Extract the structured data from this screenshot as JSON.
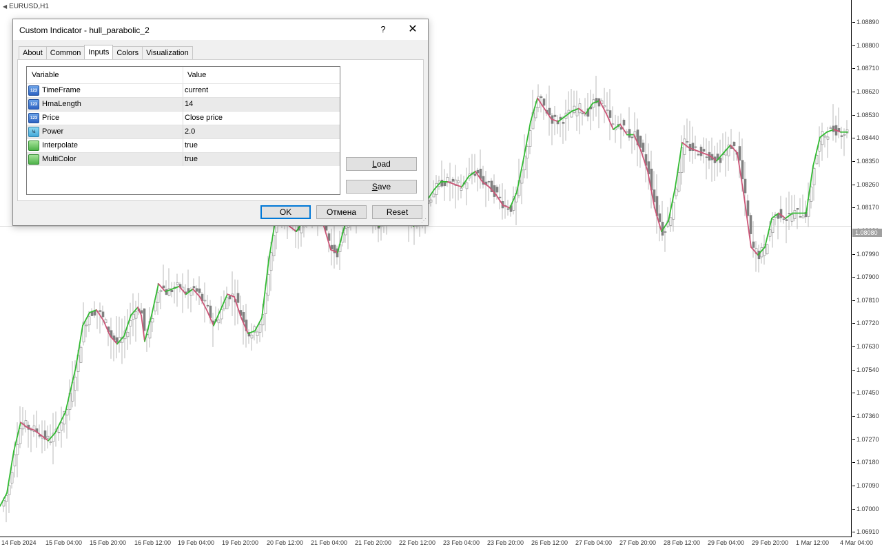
{
  "chart": {
    "symbol_label": "EURUSD,H1",
    "price_ticks": [
      "1.08890",
      "1.08800",
      "1.08710",
      "1.08620",
      "1.08530",
      "1.08440",
      "1.08350",
      "1.08260",
      "1.08170",
      "1.08080",
      "1.07990",
      "1.07900",
      "1.07810",
      "1.07720",
      "1.07630",
      "1.07540",
      "1.07450",
      "1.07360",
      "1.07270",
      "1.07180",
      "1.07090",
      "1.07000",
      "1.06910"
    ],
    "current_price": "1.08080",
    "time_ticks": [
      "14 Feb 2024",
      "15 Feb 04:00",
      "15 Feb 20:00",
      "16 Feb 12:00",
      "19 Feb 04:00",
      "19 Feb 20:00",
      "20 Feb 12:00",
      "21 Feb 04:00",
      "21 Feb 20:00",
      "22 Feb 12:00",
      "23 Feb 04:00",
      "23 Feb 20:00",
      "26 Feb 12:00",
      "27 Feb 04:00",
      "27 Feb 20:00",
      "28 Feb 12:00",
      "29 Feb 04:00",
      "29 Feb 20:00",
      "1 Mar 12:00",
      "4 Mar 04:00"
    ],
    "colors": {
      "up": "#33bb33",
      "down": "#cc5577",
      "candle": "#808080",
      "wick": "#b8b8b8"
    },
    "ylim": [
      1.06891,
      1.08945
    ],
    "hma_path": [
      [
        0,
        1.0701
      ],
      [
        10,
        1.0706
      ],
      [
        20,
        1.0722
      ],
      [
        30,
        1.0733
      ],
      [
        40,
        1.0731
      ],
      [
        50,
        1.073
      ],
      [
        60,
        1.0728
      ],
      [
        70,
        1.0726
      ],
      [
        80,
        1.0729
      ],
      [
        95,
        1.0737
      ],
      [
        110,
        1.0754
      ],
      [
        120,
        1.077
      ],
      [
        130,
        1.0775
      ],
      [
        140,
        1.0776
      ],
      [
        150,
        1.0772
      ],
      [
        160,
        1.0766
      ],
      [
        170,
        1.0763
      ],
      [
        180,
        1.0766
      ],
      [
        190,
        1.0774
      ],
      [
        200,
        1.0777
      ],
      [
        205,
        1.0774
      ],
      [
        210,
        1.0764
      ],
      [
        220,
        1.0774
      ],
      [
        230,
        1.0786
      ],
      [
        240,
        1.0783
      ],
      [
        250,
        1.0784
      ],
      [
        260,
        1.0785
      ],
      [
        270,
        1.0782
      ],
      [
        280,
        1.0784
      ],
      [
        290,
        1.0781
      ],
      [
        300,
        1.0776
      ],
      [
        310,
        1.077
      ],
      [
        320,
        1.0776
      ],
      [
        330,
        1.0782
      ],
      [
        340,
        1.0781
      ],
      [
        350,
        1.0773
      ],
      [
        360,
        1.0767
      ],
      [
        370,
        1.0768
      ],
      [
        380,
        1.0773
      ],
      [
        390,
        1.0795
      ],
      [
        400,
        1.0811
      ],
      [
        410,
        1.0813
      ],
      [
        420,
        1.0808
      ],
      [
        430,
        1.0806
      ],
      [
        440,
        1.081
      ],
      [
        450,
        1.0816
      ],
      [
        460,
        1.0814
      ],
      [
        470,
        1.0808
      ],
      [
        480,
        1.0799
      ],
      [
        490,
        1.0798
      ],
      [
        500,
        1.0808
      ],
      [
        510,
        1.0812
      ],
      [
        520,
        1.0818
      ],
      [
        530,
        1.0817
      ],
      [
        540,
        1.0811
      ],
      [
        550,
        1.0808
      ],
      [
        560,
        1.0811
      ],
      [
        570,
        1.082
      ],
      [
        580,
        1.0819
      ],
      [
        590,
        1.0812
      ],
      [
        600,
        1.0808
      ],
      [
        610,
        1.0814
      ],
      [
        620,
        1.0818
      ],
      [
        630,
        1.0822
      ],
      [
        640,
        1.0825
      ],
      [
        650,
        1.0825
      ],
      [
        660,
        1.0824
      ],
      [
        670,
        1.0823
      ],
      [
        680,
        1.0827
      ],
      [
        690,
        1.0829
      ],
      [
        700,
        1.0825
      ],
      [
        710,
        1.0823
      ],
      [
        720,
        1.082
      ],
      [
        730,
        1.0816
      ],
      [
        740,
        1.0815
      ],
      [
        750,
        1.0821
      ],
      [
        760,
        1.0834
      ],
      [
        770,
        1.0848
      ],
      [
        780,
        1.0857
      ],
      [
        790,
        1.0853
      ],
      [
        800,
        1.0849
      ],
      [
        810,
        1.0848
      ],
      [
        820,
        1.085
      ],
      [
        830,
        1.0852
      ],
      [
        840,
        1.0853
      ],
      [
        850,
        1.0851
      ],
      [
        860,
        1.0855
      ],
      [
        870,
        1.0856
      ],
      [
        880,
        1.0851
      ],
      [
        890,
        1.0845
      ],
      [
        900,
        1.0847
      ],
      [
        910,
        1.0843
      ],
      [
        920,
        1.0843
      ],
      [
        930,
        1.0837
      ],
      [
        940,
        1.0829
      ],
      [
        950,
        1.0815
      ],
      [
        960,
        1.0806
      ],
      [
        970,
        1.081
      ],
      [
        980,
        1.0823
      ],
      [
        990,
        1.084
      ],
      [
        1000,
        1.0838
      ],
      [
        1010,
        1.0837
      ],
      [
        1020,
        1.0836
      ],
      [
        1030,
        1.0835
      ],
      [
        1040,
        1.0833
      ],
      [
        1050,
        1.0836
      ],
      [
        1060,
        1.0839
      ],
      [
        1070,
        1.0836
      ],
      [
        1080,
        1.0819
      ],
      [
        1090,
        1.08
      ],
      [
        1100,
        1.0797
      ],
      [
        1110,
        1.08
      ],
      [
        1120,
        1.0811
      ],
      [
        1130,
        1.0813
      ],
      [
        1140,
        1.0811
      ],
      [
        1150,
        1.0813
      ],
      [
        1160,
        1.0813
      ],
      [
        1170,
        1.0813
      ],
      [
        1180,
        1.0831
      ],
      [
        1190,
        1.0842
      ],
      [
        1200,
        1.0844
      ],
      [
        1210,
        1.0845
      ],
      [
        1220,
        1.0844
      ],
      [
        1230,
        1.0844
      ]
    ]
  },
  "dialog": {
    "title": "Custom Indicator - hull_parabolic_2",
    "help": "?",
    "close": "✕",
    "tabs": [
      {
        "label": "About"
      },
      {
        "label": "Common"
      },
      {
        "label": "Inputs",
        "active": true
      },
      {
        "label": "Colors"
      },
      {
        "label": "Visualization"
      }
    ],
    "grid": {
      "col_variable": "Variable",
      "col_value": "Value",
      "rows": [
        {
          "icon": "int",
          "icon_text": "123",
          "name": "TimeFrame",
          "value": "current"
        },
        {
          "icon": "int",
          "icon_text": "123",
          "name": "HmaLength",
          "value": "14"
        },
        {
          "icon": "int",
          "icon_text": "123",
          "name": "Price",
          "value": "Close price"
        },
        {
          "icon": "dbl",
          "icon_text": "½",
          "name": "Power",
          "value": "2.0"
        },
        {
          "icon": "bool",
          "icon_text": "",
          "name": "Interpolate",
          "value": "true"
        },
        {
          "icon": "bool",
          "icon_text": "",
          "name": "MultiColor",
          "value": "true"
        }
      ]
    },
    "load_label": "Load",
    "load_mnemonic": "L",
    "load_rest": "oad",
    "save_label": "Save",
    "save_mnemonic": "S",
    "save_rest": "ave",
    "ok_label": "OK",
    "cancel_label": "Отмена",
    "reset_label": "Reset"
  }
}
